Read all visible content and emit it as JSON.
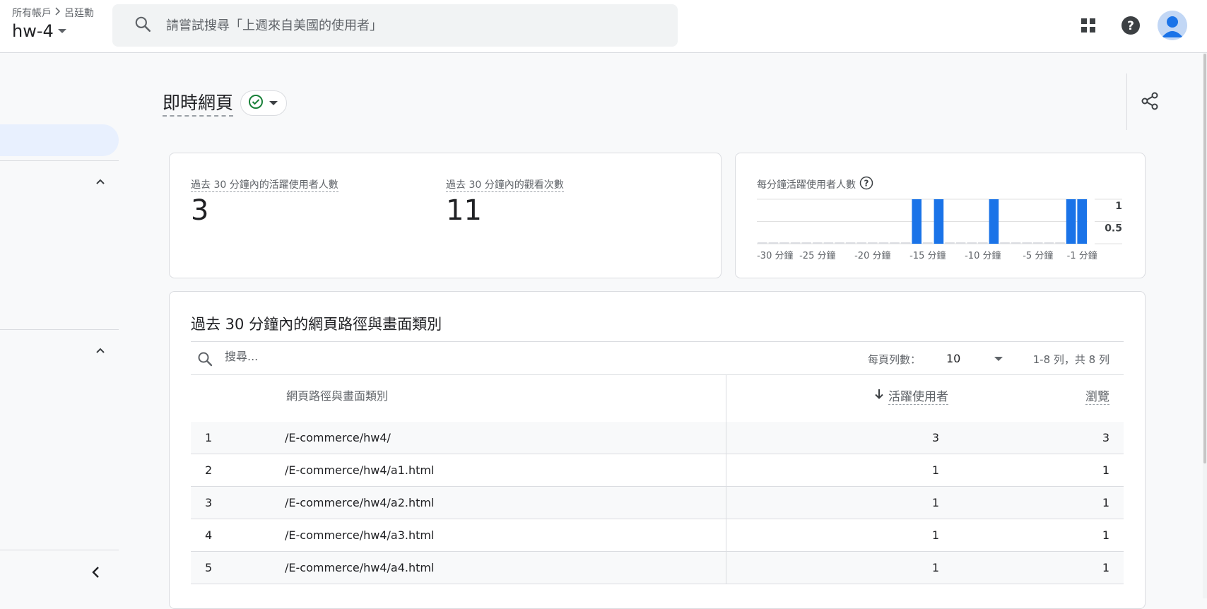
{
  "header": {
    "breadcrumb": [
      "所有帳戶",
      "呂廷勳"
    ],
    "account": "hw-4",
    "search_placeholder": "請嘗試搜尋「上週來自美國的使用者」"
  },
  "page": {
    "title": "即時網頁"
  },
  "metrics": [
    {
      "label": "過去 30 分鐘內的活躍使用者人數",
      "value": "3"
    },
    {
      "label": "過去 30 分鐘內的觀看次數",
      "value": "11"
    }
  ],
  "chart_data": {
    "type": "bar",
    "title": "每分鐘活躍使用者人數",
    "categories": [
      "-30",
      "-29",
      "-28",
      "-27",
      "-26",
      "-25",
      "-24",
      "-23",
      "-22",
      "-21",
      "-20",
      "-19",
      "-18",
      "-17",
      "-16",
      "-15",
      "-14",
      "-13",
      "-12",
      "-11",
      "-10",
      "-9",
      "-8",
      "-7",
      "-6",
      "-5",
      "-4",
      "-3",
      "-2",
      "-1"
    ],
    "values": [
      0,
      0,
      0,
      0,
      0,
      0,
      0,
      0,
      0,
      0,
      0,
      0,
      0,
      0,
      1,
      0,
      1,
      0,
      0,
      0,
      0,
      1,
      0,
      0,
      0,
      0,
      0,
      0,
      1,
      1
    ],
    "xtick_labels": [
      "-30 分鐘",
      "-25 分鐘",
      "-20 分鐘",
      "-15 分鐘",
      "-10 分鐘",
      "-5 分鐘",
      "-1 分鐘"
    ],
    "ytick_labels": [
      "1",
      "0.5"
    ],
    "ylim": [
      0,
      1
    ],
    "color": "#1a73e8"
  },
  "table": {
    "title": "過去 30 分鐘內的網頁路徑與畫面類別",
    "search_placeholder": "搜尋...",
    "rows_per_page_label": "每頁列數：",
    "rows_per_page": "10",
    "range": "1-8 列，共 8 列",
    "columns": {
      "path": "網頁路徑與畫面類別",
      "active": "活躍使用者",
      "views": "瀏覽"
    },
    "rows": [
      {
        "idx": "1",
        "path": "/E-commerce/hw4/",
        "active": "3",
        "views": "3"
      },
      {
        "idx": "2",
        "path": "/E-commerce/hw4/a1.html",
        "active": "1",
        "views": "1"
      },
      {
        "idx": "3",
        "path": "/E-commerce/hw4/a2.html",
        "active": "1",
        "views": "1"
      },
      {
        "idx": "4",
        "path": "/E-commerce/hw4/a3.html",
        "active": "1",
        "views": "1"
      },
      {
        "idx": "5",
        "path": "/E-commerce/hw4/a4.html",
        "active": "1",
        "views": "1"
      }
    ]
  }
}
